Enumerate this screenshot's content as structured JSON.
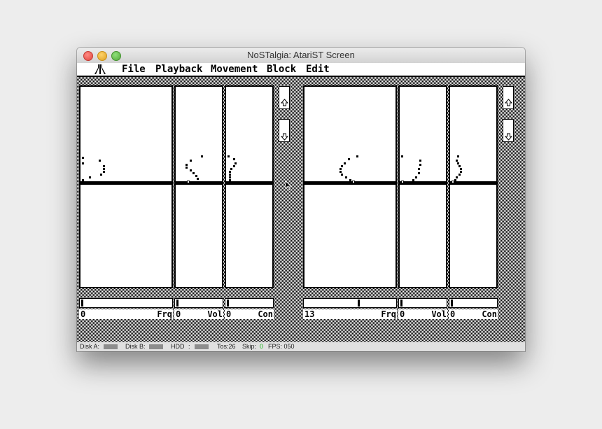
{
  "window": {
    "title": "NoSTalgia: AtariST Screen"
  },
  "menu": {
    "atari_icon": "atari-fuji-logo",
    "items": [
      "File",
      "Playback",
      "Movement",
      "Block",
      "Edit"
    ]
  },
  "channels": {
    "left": [
      {
        "value": "0",
        "label": "Frq"
      },
      {
        "value": "0",
        "label": "Vol"
      },
      {
        "value": "0",
        "label": "Con"
      }
    ],
    "right": [
      {
        "value": "13",
        "label": "Frq"
      },
      {
        "value": "0",
        "label": "Vol"
      },
      {
        "value": "0",
        "label": "Con"
      }
    ]
  },
  "scroll_buttons": {
    "up_icon": "arrow-up-icon",
    "down_icon": "arrow-down-icon"
  },
  "status": {
    "disk_a": "Disk A:",
    "disk_b": "Disk B:",
    "hdd": "HDD",
    "colon": ":",
    "tos": "Tos:26",
    "skip_label": "Skip:",
    "skip_value": "0",
    "fps": "FPS: 050"
  },
  "colors": {
    "skip_value": "#1bb51b",
    "desktop_pattern": "#000000"
  }
}
